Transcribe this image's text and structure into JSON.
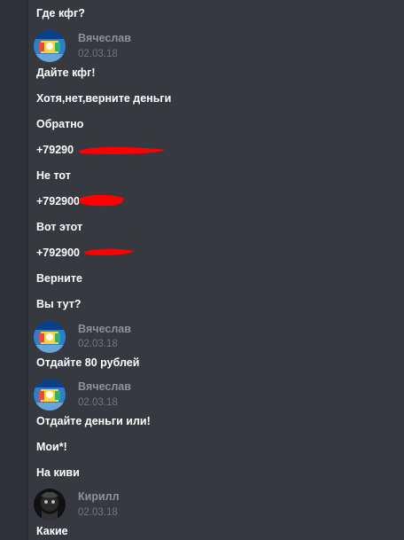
{
  "messages": {
    "m0": "Где кфг?",
    "g1": {
      "author": "Вячеслав",
      "timestamp": "02.03.18",
      "avatar_icon": "user-avatar-icon"
    },
    "m1": "Дайте кфг!",
    "m2": "Хотя,нет,верните деньги",
    "m3": "Обратно",
    "m4": "+79290",
    "m5": "Не тот",
    "m6": "+792900",
    "m7": "Вот этот",
    "m8": "+792900",
    "m9": "Верните",
    "m10": "Вы тут?",
    "g2": {
      "author": "Вячеслав",
      "timestamp": "02.03.18",
      "avatar_icon": "user-avatar-icon"
    },
    "m11": "Отдайте 80 рублей",
    "g3": {
      "author": "Вячеслав",
      "timestamp": "02.03.18",
      "avatar_icon": "user-avatar-icon"
    },
    "m12": "Отдайте деньги или!",
    "m13": "Мои*!",
    "m14": "На киви",
    "g4": {
      "author": "Кирилл",
      "timestamp": "02.03.18",
      "avatar_icon": "user-avatar-icon"
    },
    "m15": "Какие"
  },
  "colors": {
    "background": "#36393f",
    "text": "#ffffff",
    "author": "#8e9297",
    "timestamp": "#72767d",
    "redaction": "#ff0000"
  }
}
